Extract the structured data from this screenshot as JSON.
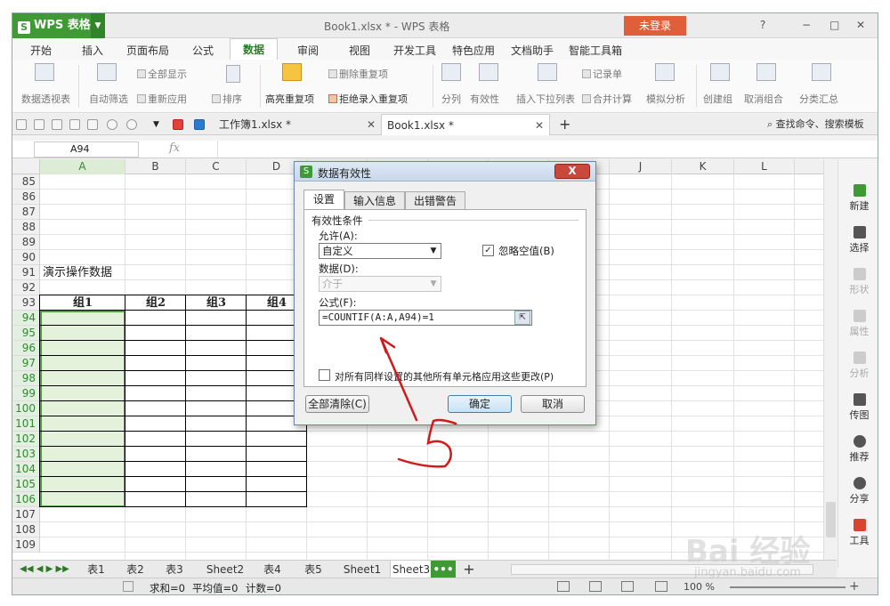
{
  "app": {
    "name": "WPS 表格",
    "window_title": "Book1.xlsx * - WPS 表格",
    "login_label": "未登录",
    "title_controls": [
      "?",
      "−",
      "□",
      "✕"
    ]
  },
  "menu": [
    "开始",
    "插入",
    "页面布局",
    "公式",
    "数据",
    "审阅",
    "视图",
    "开发工具",
    "特色应用",
    "文档助手",
    "智能工具箱"
  ],
  "active_menu": "数据",
  "ribbon": {
    "pivot": "数据透视表",
    "autofilter": "自动筛选",
    "show_all": "全部显示",
    "reapply": "重新应用",
    "sort": "排序",
    "highlight_dup": "高亮重复项",
    "remove_dup": "删除重复项",
    "reject_dup": "拒绝录入重复项",
    "split": "分列",
    "validity": "有效性",
    "dropdown_list": "插入下拉列表",
    "records": "记录单",
    "merge_calc": "合并计算",
    "simulate": "模拟分析",
    "create_group": "创建组",
    "cancel_group": "取消组合",
    "subtotal": "分类汇总"
  },
  "doc_tabs": [
    "工作簿1.xlsx *",
    "Book1.xlsx *"
  ],
  "search_label": "查找命令、搜索模板",
  "name_box": "A94",
  "fx": "fx",
  "columns": [
    "A",
    "B",
    "C",
    "D",
    "E",
    "F",
    "G",
    "H",
    "I",
    "J",
    "K",
    "L"
  ],
  "rows": [
    "85",
    "86",
    "87",
    "88",
    "89",
    "90",
    "91",
    "92",
    "93",
    "94",
    "95",
    "96",
    "97",
    "98",
    "99",
    "100",
    "101",
    "102",
    "103",
    "104",
    "105",
    "106",
    "107",
    "108",
    "109"
  ],
  "sheet_content": {
    "a91": "演示操作数据",
    "headers": [
      "组1",
      "组2",
      "组3",
      "组4"
    ]
  },
  "side_panel": [
    "新建",
    "选择",
    "形状",
    "属性",
    "分析",
    "传图",
    "推荐",
    "分享",
    "工具"
  ],
  "sheet_tabs": [
    "表1",
    "表2",
    "表3",
    "Sheet2",
    "表4",
    "表5",
    "Sheet1",
    "Sheet3"
  ],
  "more_tabs": "•••",
  "status": {
    "sum": "求和=0",
    "avg": "平均值=0",
    "count": "计数=0",
    "zoom": "100 %"
  },
  "dialog": {
    "title": "数据有效性",
    "close": "X",
    "tabs": [
      "设置",
      "输入信息",
      "出错警告"
    ],
    "group_label": "有效性条件",
    "allow_label": "允许(A):",
    "allow_value": "自定义",
    "ignore_blank_label": "忽略空值(B)",
    "ignore_blank_checked": "✓",
    "data_label": "数据(D):",
    "data_value": "介于",
    "formula_label": "公式(F):",
    "formula_value": "=COUNTIF(A:A,A94)=1",
    "apply_all_label": "对所有同样设置的其他所有单元格应用这些更改(P)",
    "clear_all": "全部清除(C)",
    "ok": "确定",
    "cancel": "取消"
  },
  "annotation": {
    "stroke_color": "#d01a1a"
  },
  "watermark": {
    "brand": "Bai 经验",
    "url": "jingyan.baidu.com"
  }
}
